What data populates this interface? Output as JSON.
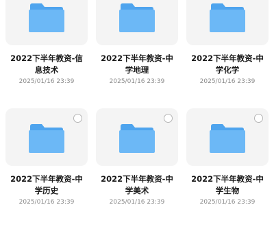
{
  "colors": {
    "folder_front": "#6cb8f6",
    "folder_back": "#4ea4ee",
    "card_bg": "#f4f4f4"
  },
  "files": [
    {
      "name": "2022下半年教资-信息技术",
      "date": "2025/01/16 23:39",
      "icon": "folder-icon"
    },
    {
      "name": "2022下半年教资-中学地理",
      "date": "2025/01/16 23:39",
      "icon": "folder-icon"
    },
    {
      "name": "2022下半年教资-中学化学",
      "date": "2025/01/16 23:39",
      "icon": "folder-icon"
    },
    {
      "name": "2022下半年教资-中学历史",
      "date": "2025/01/16 23:39",
      "icon": "folder-icon"
    },
    {
      "name": "2022下半年教资-中学美术",
      "date": "2025/01/16 23:39",
      "icon": "folder-icon"
    },
    {
      "name": "2022下半年教资-中学生物",
      "date": "2025/01/16 23:39",
      "icon": "folder-icon"
    }
  ]
}
